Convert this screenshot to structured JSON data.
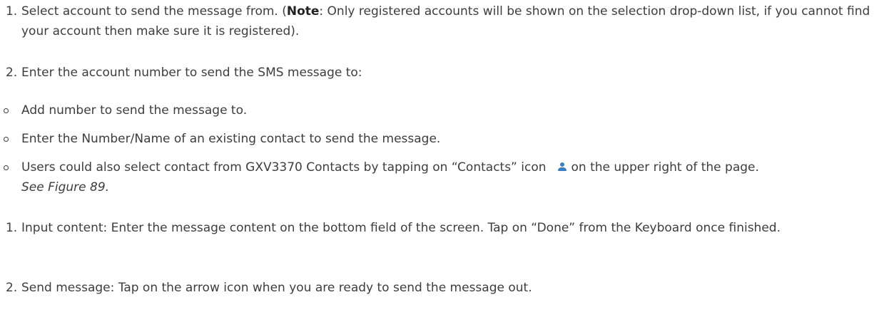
{
  "list1": {
    "item1": {
      "number": "1.",
      "text_before": "Select account to send the message from. (",
      "note_label": "Note",
      "text_after": ": Only registered accounts will be shown on the selection drop-down list, if you cannot find your account then make sure it is registered)."
    },
    "item2": {
      "number": "2.",
      "text": "Enter the account number to send the SMS message to:"
    }
  },
  "bullets": [
    {
      "text": "Add number to send the message to."
    },
    {
      "text": "Enter the Number/Name of an existing contact to send the message."
    },
    {
      "text_before": "Users could also select contact from GXV3370 Contacts by tapping on “Contacts” icon",
      "icon": "contacts-icon",
      "text_after": "on the upper right of the page.",
      "figure_ref": "See Figure 89."
    }
  ],
  "list2": {
    "item1": {
      "number": "1.",
      "text": "Input content: Enter the message content on the bottom field of the screen. Tap on “Done” from the Keyboard once finished."
    },
    "item2": {
      "number": "2.",
      "text": "Send message: Tap on the arrow icon when you are ready to send the message out."
    }
  },
  "colors": {
    "text": "#3d3d3d",
    "icon": "#2f7fd6"
  }
}
